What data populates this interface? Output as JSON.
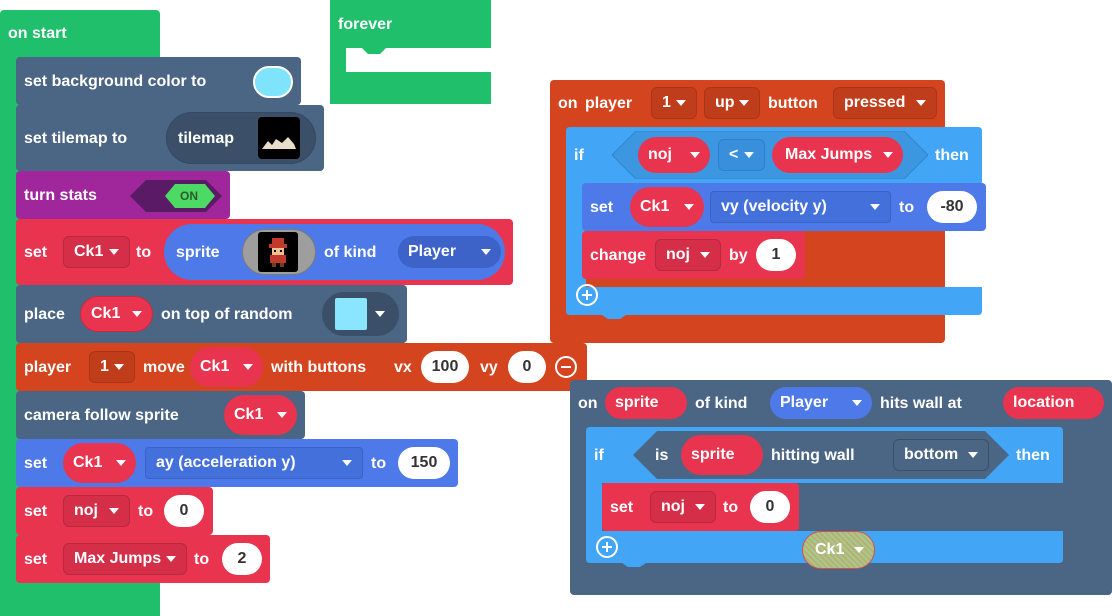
{
  "colors": {
    "events": "#20bf6b",
    "scene": "#4b6584",
    "sprites": "#e8344f",
    "controller": "#d4451f",
    "logic": "#42a5f5",
    "stats": "#a0269b",
    "variables": "#e8344f"
  },
  "on_start": {
    "hat_label": "on start",
    "set_bg": {
      "label": "set background color to",
      "color": "#7fe3fb"
    },
    "set_tilemap": {
      "label": "set tilemap to",
      "value": "tilemap"
    },
    "turn_stats": {
      "label": "turn stats",
      "toggle": "ON"
    },
    "set_sprite": {
      "set": "set",
      "var": "Ck1",
      "to": "to",
      "sprite": "sprite",
      "of_kind": "of kind",
      "kind": "Player"
    },
    "place": {
      "label": "place",
      "var": "Ck1",
      "on_top": "on top of random",
      "tile_color": "#8ae6ff"
    },
    "player_move": {
      "player": "player",
      "num": "1",
      "move": "move",
      "var": "Ck1",
      "with_buttons": "with buttons",
      "vx_label": "vx",
      "vx": "100",
      "vy_label": "vy",
      "vy": "0"
    },
    "camera": {
      "label": "camera follow sprite",
      "var": "Ck1"
    },
    "set_ay": {
      "set": "set",
      "var": "Ck1",
      "prop": "ay (acceleration y)",
      "to": "to",
      "value": "150"
    },
    "set_noj": {
      "set": "set",
      "var": "noj",
      "to": "to",
      "value": "0"
    },
    "set_maxjumps": {
      "set": "set",
      "var": "Max Jumps",
      "to": "to",
      "value": "2"
    }
  },
  "forever": {
    "label": "forever"
  },
  "on_button": {
    "on": "on",
    "player": "player",
    "num": "1",
    "button": "up",
    "button_label": "button",
    "event": "pressed",
    "if": "if",
    "left": "noj",
    "op": "<",
    "right": "Max Jumps",
    "then": "then",
    "set": {
      "set": "set",
      "var": "Ck1",
      "prop": "vy (velocity y)",
      "to": "to",
      "value": "-80"
    },
    "change": {
      "change": "change",
      "var": "noj",
      "by": "by",
      "value": "1"
    }
  },
  "on_wall": {
    "on": "on",
    "param": "sprite",
    "of_kind": "of kind",
    "kind": "Player",
    "hits": "hits wall at",
    "loc": "location",
    "if": "if",
    "is": "is",
    "sprite": "sprite",
    "hitting": "hitting wall",
    "side": "bottom",
    "then": "then",
    "set": {
      "set": "set",
      "var": "noj",
      "to": "to",
      "value": "0"
    },
    "ghost": "Ck1"
  }
}
